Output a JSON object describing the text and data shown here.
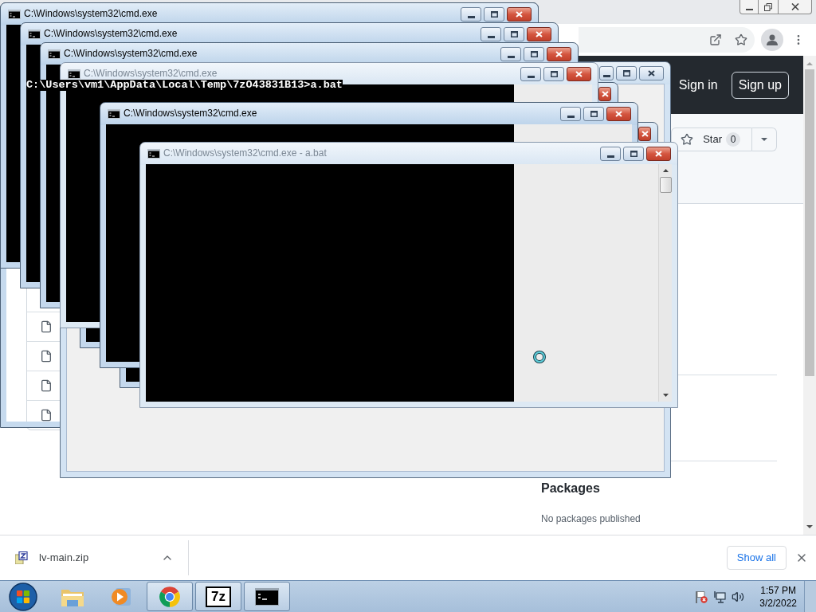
{
  "browser": {
    "header": {
      "sign_in": "Sign in",
      "sign_up": "Sign up"
    },
    "star_button": {
      "label": "Star",
      "count": "0"
    },
    "sidebar": {
      "heading": "Packages",
      "note": "No packages published"
    }
  },
  "windows": [
    {
      "kind": "frame"
    },
    {
      "kind": "blank"
    },
    {
      "kind": "console",
      "title": "C:\\Windows\\system32\\cmd.exe",
      "dimmed": false
    },
    {
      "kind": "console",
      "title": "C:\\Windows\\system32\\cmd.exe",
      "dimmed": false
    },
    {
      "kind": "console",
      "title": "C:\\Windows\\system32\\cmd.exe",
      "dimmed": false
    },
    {
      "kind": "console"
    },
    {
      "kind": "console",
      "title": "C:\\Windows\\system32\\cmd.exe",
      "dimmed": true
    },
    {
      "kind": "console"
    },
    {
      "kind": "console",
      "title": "C:\\Windows\\system32\\cmd.exe",
      "dimmed": false
    },
    {
      "kind": "console",
      "title": "C:\\Windows\\system32\\cmd.exe - a.bat",
      "dimmed": true
    }
  ],
  "console_line": "C:\\Users\\vm1\\AppData\\Local\\Temp\\7zO43831B13>a.bat",
  "download_bar": {
    "items": [
      {
        "file_name": "lv-main.zip"
      }
    ],
    "show_all": "Show all"
  },
  "taskbar": {
    "apps": [
      {
        "kind": "folder",
        "open": false
      },
      {
        "kind": "media",
        "open": false
      },
      {
        "kind": "browser",
        "open": true
      },
      {
        "kind": "archive",
        "open": true,
        "icon_text": "7z"
      },
      {
        "kind": "console",
        "open": true
      }
    ],
    "clock": {
      "time": "1:57 PM",
      "date": "3/2/2022"
    }
  }
}
